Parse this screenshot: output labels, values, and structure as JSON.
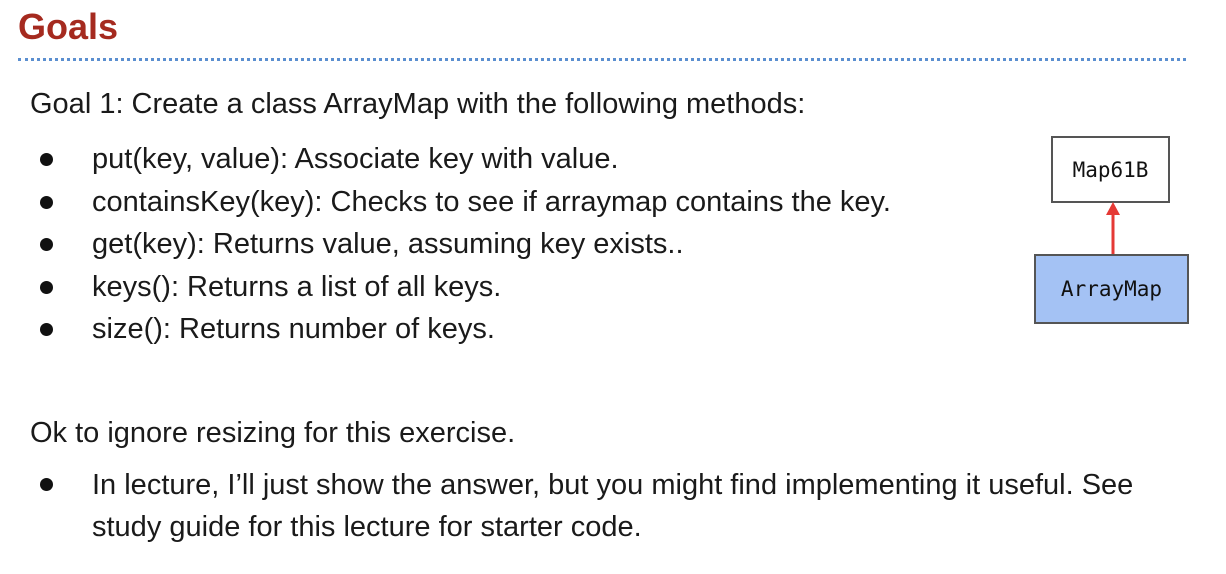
{
  "header": {
    "title": "Goals",
    "title_color": "#a52a1f",
    "divider_color": "#5b8fd0"
  },
  "goal": {
    "text": "Goal 1: Create a class ArrayMap with the following methods:",
    "methods": [
      "put(key, value): Associate key with value.",
      "containsKey(key): Checks to see if arraymap contains the key.",
      "get(key): Returns value, assuming key exists..",
      "keys(): Returns a list of all keys.",
      "size(): Returns number of keys."
    ]
  },
  "note": {
    "text": "Ok to ignore resizing for this exercise.",
    "items": [
      "In lecture, I’ll just show the answer, but you might find implementing it useful. See study guide for this lecture for starter code."
    ]
  },
  "diagram": {
    "parent_label": "Map61B",
    "child_label": "ArrayMap",
    "child_fill": "#a4c2f4",
    "arrow_color": "#e53935"
  }
}
